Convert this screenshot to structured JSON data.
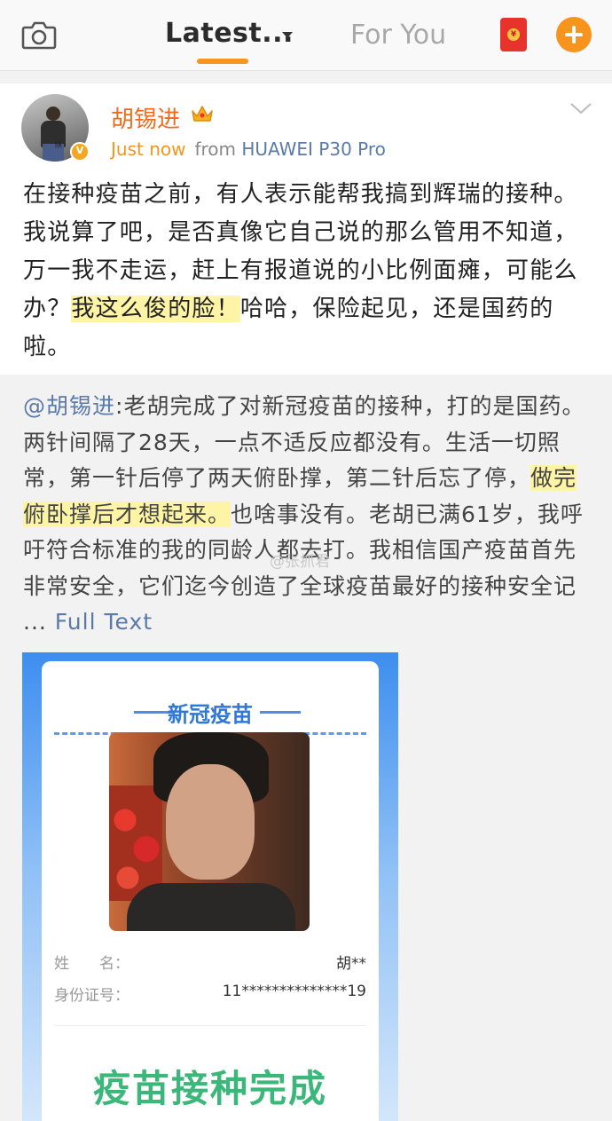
{
  "nav": {
    "latest_label": "Latest...",
    "for_you_label": "For You",
    "accent_color": "#f7941d",
    "icons": [
      "camera-icon",
      "chevron-down-icon",
      "red-packet-icon",
      "plus-icon"
    ]
  },
  "post": {
    "author": "胡锡进",
    "time": "Just now",
    "source_prefix": "from",
    "device": "HUAWEI P30 Pro",
    "avatar_caption": "陕",
    "text_before": "在接种疫苗之前，有人表示能帮我搞到辉瑞的接种。我说算了吧，是否真像它自己说的那么管用不知道，万一我不走运，赶上有报道说的小比例面瘫，可能么办？",
    "text_highlight": "我这么俊的脸！",
    "text_after": "哈哈，保险起见，还是国药的啦。"
  },
  "repost": {
    "mention": "@胡锡进",
    "text_before": ":老胡完成了对新冠疫苗的接种，打的是国药。两针间隔了28天，一点不适反应都没有。生活一切照常，第一针后停了两天俯卧撑，第二针后忘了停，",
    "text_highlight": "做完俯卧撑后才想起来。",
    "text_after": "也啥事没有。老胡已满61岁，我呼吁符合标准的我的同龄人都去打。我相信国产疫苗首先非常安全，它们迄今创造了全球疫苗最好的接种安全记 ...",
    "full_text_label": "Full Text",
    "watermark": "@张抓君"
  },
  "card": {
    "title": "新冠疫苗",
    "name_label": "姓　　名：",
    "name_value": "胡**",
    "id_label": "身份证号：",
    "id_value": "11**************19",
    "status": "疫苗接种完成"
  }
}
